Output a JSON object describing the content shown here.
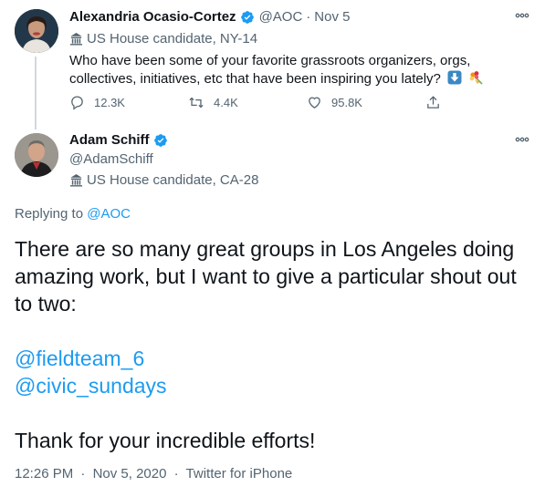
{
  "parent_tweet": {
    "author_name": "Alexandria Ocasio-Cortez",
    "handle": "@AOC",
    "separator": "·",
    "date": "Nov 5",
    "label": "US House candidate, NY-14",
    "text": "Who have been some of your favorite grassroots organizers, orgs, collectives, initiatives, etc that have been inspiring you lately?",
    "emoji_icons": [
      "down-arrow-emoji-icon",
      "bouquet-emoji-icon"
    ],
    "reply_count": "12.3K",
    "retweet_count": "4.4K",
    "like_count": "95.8K"
  },
  "main_tweet": {
    "author_name": "Adam Schiff",
    "handle": "@AdamSchiff",
    "label": "US House candidate, CA-28",
    "replying_prefix": "Replying to",
    "replying_to": "@AOC",
    "text_line1": "There are so many great groups in Los Angeles doing amazing work, but I want to give a particular shout out to two:",
    "mention1": "@fieldteam_6",
    "mention2": "@civic_sundays",
    "closing": "Thank for your incredible efforts!",
    "time": "12:26 PM",
    "date": "Nov 5, 2020",
    "source": "Twitter for iPhone",
    "separator": "·"
  },
  "colors": {
    "accent": "#1d9bf0",
    "text": "#0f1419",
    "muted": "#536471",
    "thread_line": "#cfd9de"
  }
}
